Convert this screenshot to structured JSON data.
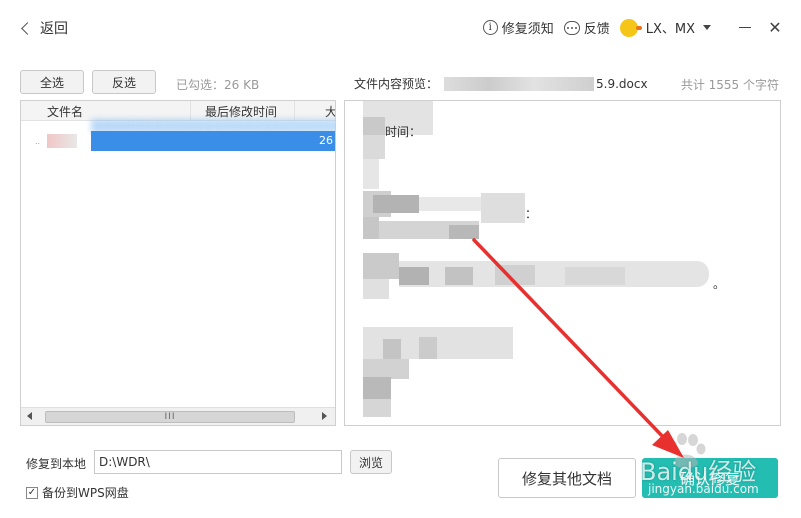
{
  "header": {
    "back_label": "返回",
    "repair_notice": "修复须知",
    "feedback": "反馈",
    "user_name": "LX、MX"
  },
  "toolbar": {
    "select_all": "全选",
    "invert": "反选",
    "selected_text": "已勾选：26 KB"
  },
  "preview": {
    "label": "文件内容预览：",
    "file_suffix": "5.9.docx",
    "char_count": "共计 1555 个字符",
    "visible_chars": [
      "时间：",
      "：",
      "。"
    ]
  },
  "file_list": {
    "columns": [
      "文件名",
      "最后修改时间",
      "大"
    ],
    "rows": [
      {
        "marker": "..",
        "size_fragment": "26"
      }
    ],
    "scroll_grip": "III"
  },
  "footer": {
    "restore_label": "修复到本地",
    "restore_path": "D:\\WDR\\",
    "browse": "浏览",
    "backup_label": "备份到WPS网盘",
    "backup_checked": true,
    "repair_other": "修复其他文档",
    "confirm": "确认修复"
  },
  "watermark": {
    "text": "Baidu经验",
    "url": "jingyan.baidu.com"
  },
  "colors": {
    "accent": "#23bdb2",
    "selection": "#3b8ee8",
    "annotation_arrow": "#e8312f"
  },
  "icons": {
    "back": "chevron-left-icon",
    "notice": "info-circle-icon",
    "feedback": "chat-bubble-icon",
    "avatar": "duck-avatar-icon",
    "dropdown": "caret-down-icon",
    "minimize": "minimize-icon",
    "close": "close-icon"
  }
}
